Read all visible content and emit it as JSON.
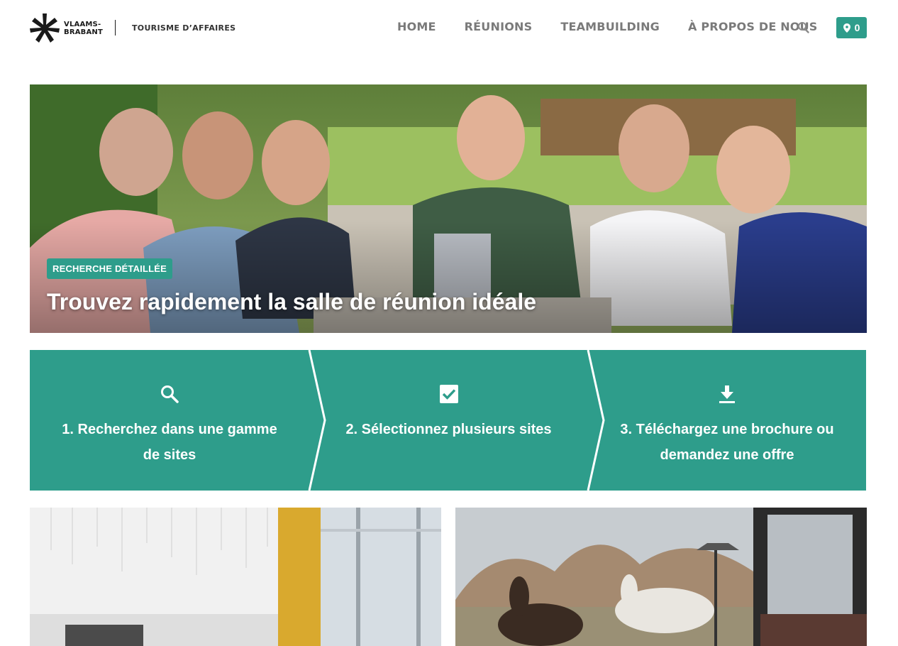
{
  "brand": {
    "logo_line1": "VLAAMS-",
    "logo_line2": "BRABANT",
    "subtitle": "TOURISME D’AFFAIRES"
  },
  "nav": {
    "items": [
      {
        "label": "HOME"
      },
      {
        "label": "RÉUNIONS"
      },
      {
        "label": "TEAMBUILDING"
      },
      {
        "label": "À PROPOS DE NOUS"
      }
    ],
    "search_icon": "search-icon",
    "cart_count": "0",
    "accent_color": "#2e9d8b"
  },
  "hero": {
    "tag": "RECHERCHE DÉTAILLÉE",
    "title": "Trouvez rapidement la salle de réunion idéale"
  },
  "steps": [
    {
      "icon": "search-icon",
      "line1": "1. Recherchez dans une gamme",
      "line2": "de sites"
    },
    {
      "icon": "checkbox-icon",
      "line1": "2. Sélectionnez plusieurs sites",
      "line2": ""
    },
    {
      "icon": "download-icon",
      "line1": "3. Téléchargez une brochure ou",
      "line2": "demandez une offre"
    }
  ]
}
